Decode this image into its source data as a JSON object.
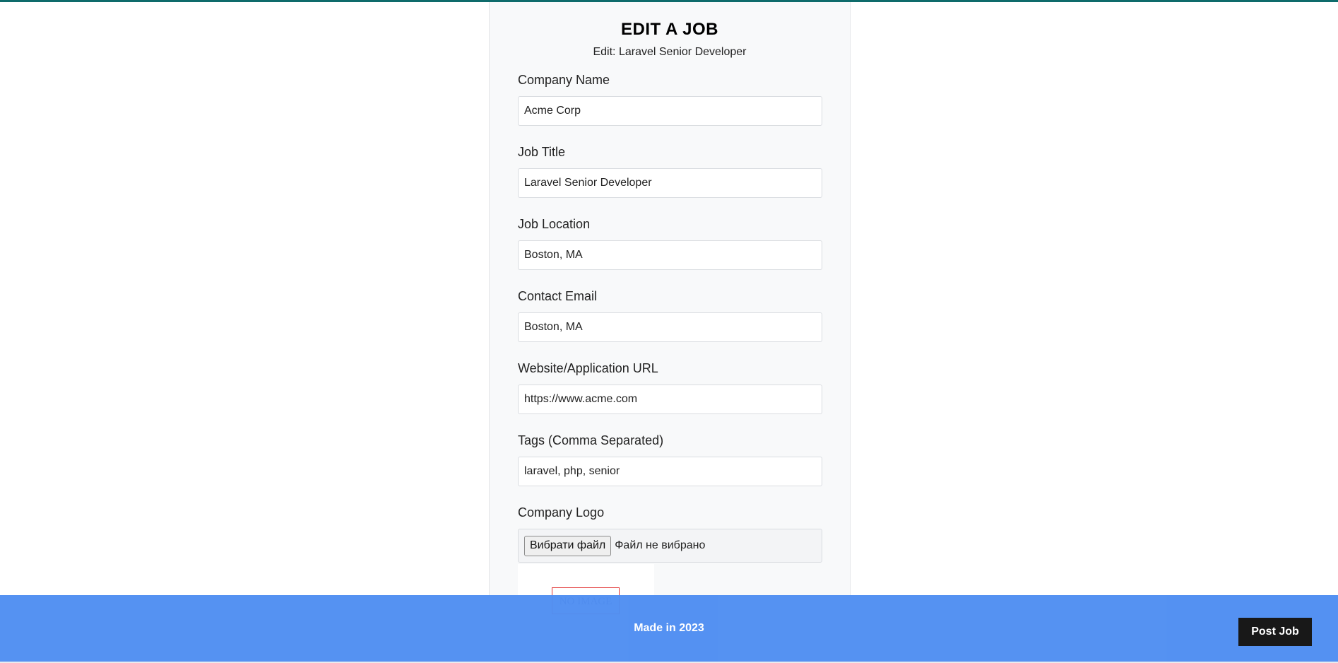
{
  "page": {
    "title": "EDIT A JOB",
    "subtitle": "Edit: Laravel Senior Developer"
  },
  "form": {
    "fields": [
      {
        "label": "Company Name",
        "value": "Acme Corp"
      },
      {
        "label": "Job Title",
        "value": "Laravel Senior Developer"
      },
      {
        "label": "Job Location",
        "value": "Boston, MA"
      },
      {
        "label": "Contact Email",
        "value": "Boston, MA"
      },
      {
        "label": "Website/Application URL",
        "value": "https://www.acme.com"
      },
      {
        "label": "Tags (Comma Separated)",
        "value": "laravel, php, senior"
      }
    ],
    "logo": {
      "label": "Company Logo",
      "button_label": "Вибрати файл",
      "status": "Файл не вибрано",
      "preview_alt": "NO IMAGE"
    }
  },
  "footer": {
    "text": "Made in 2023",
    "post_job_label": "Post Job"
  },
  "colors": {
    "topbar": "#0e6b6b",
    "footer_bg": "#4f8ef2",
    "post_job_bg": "#111111"
  }
}
